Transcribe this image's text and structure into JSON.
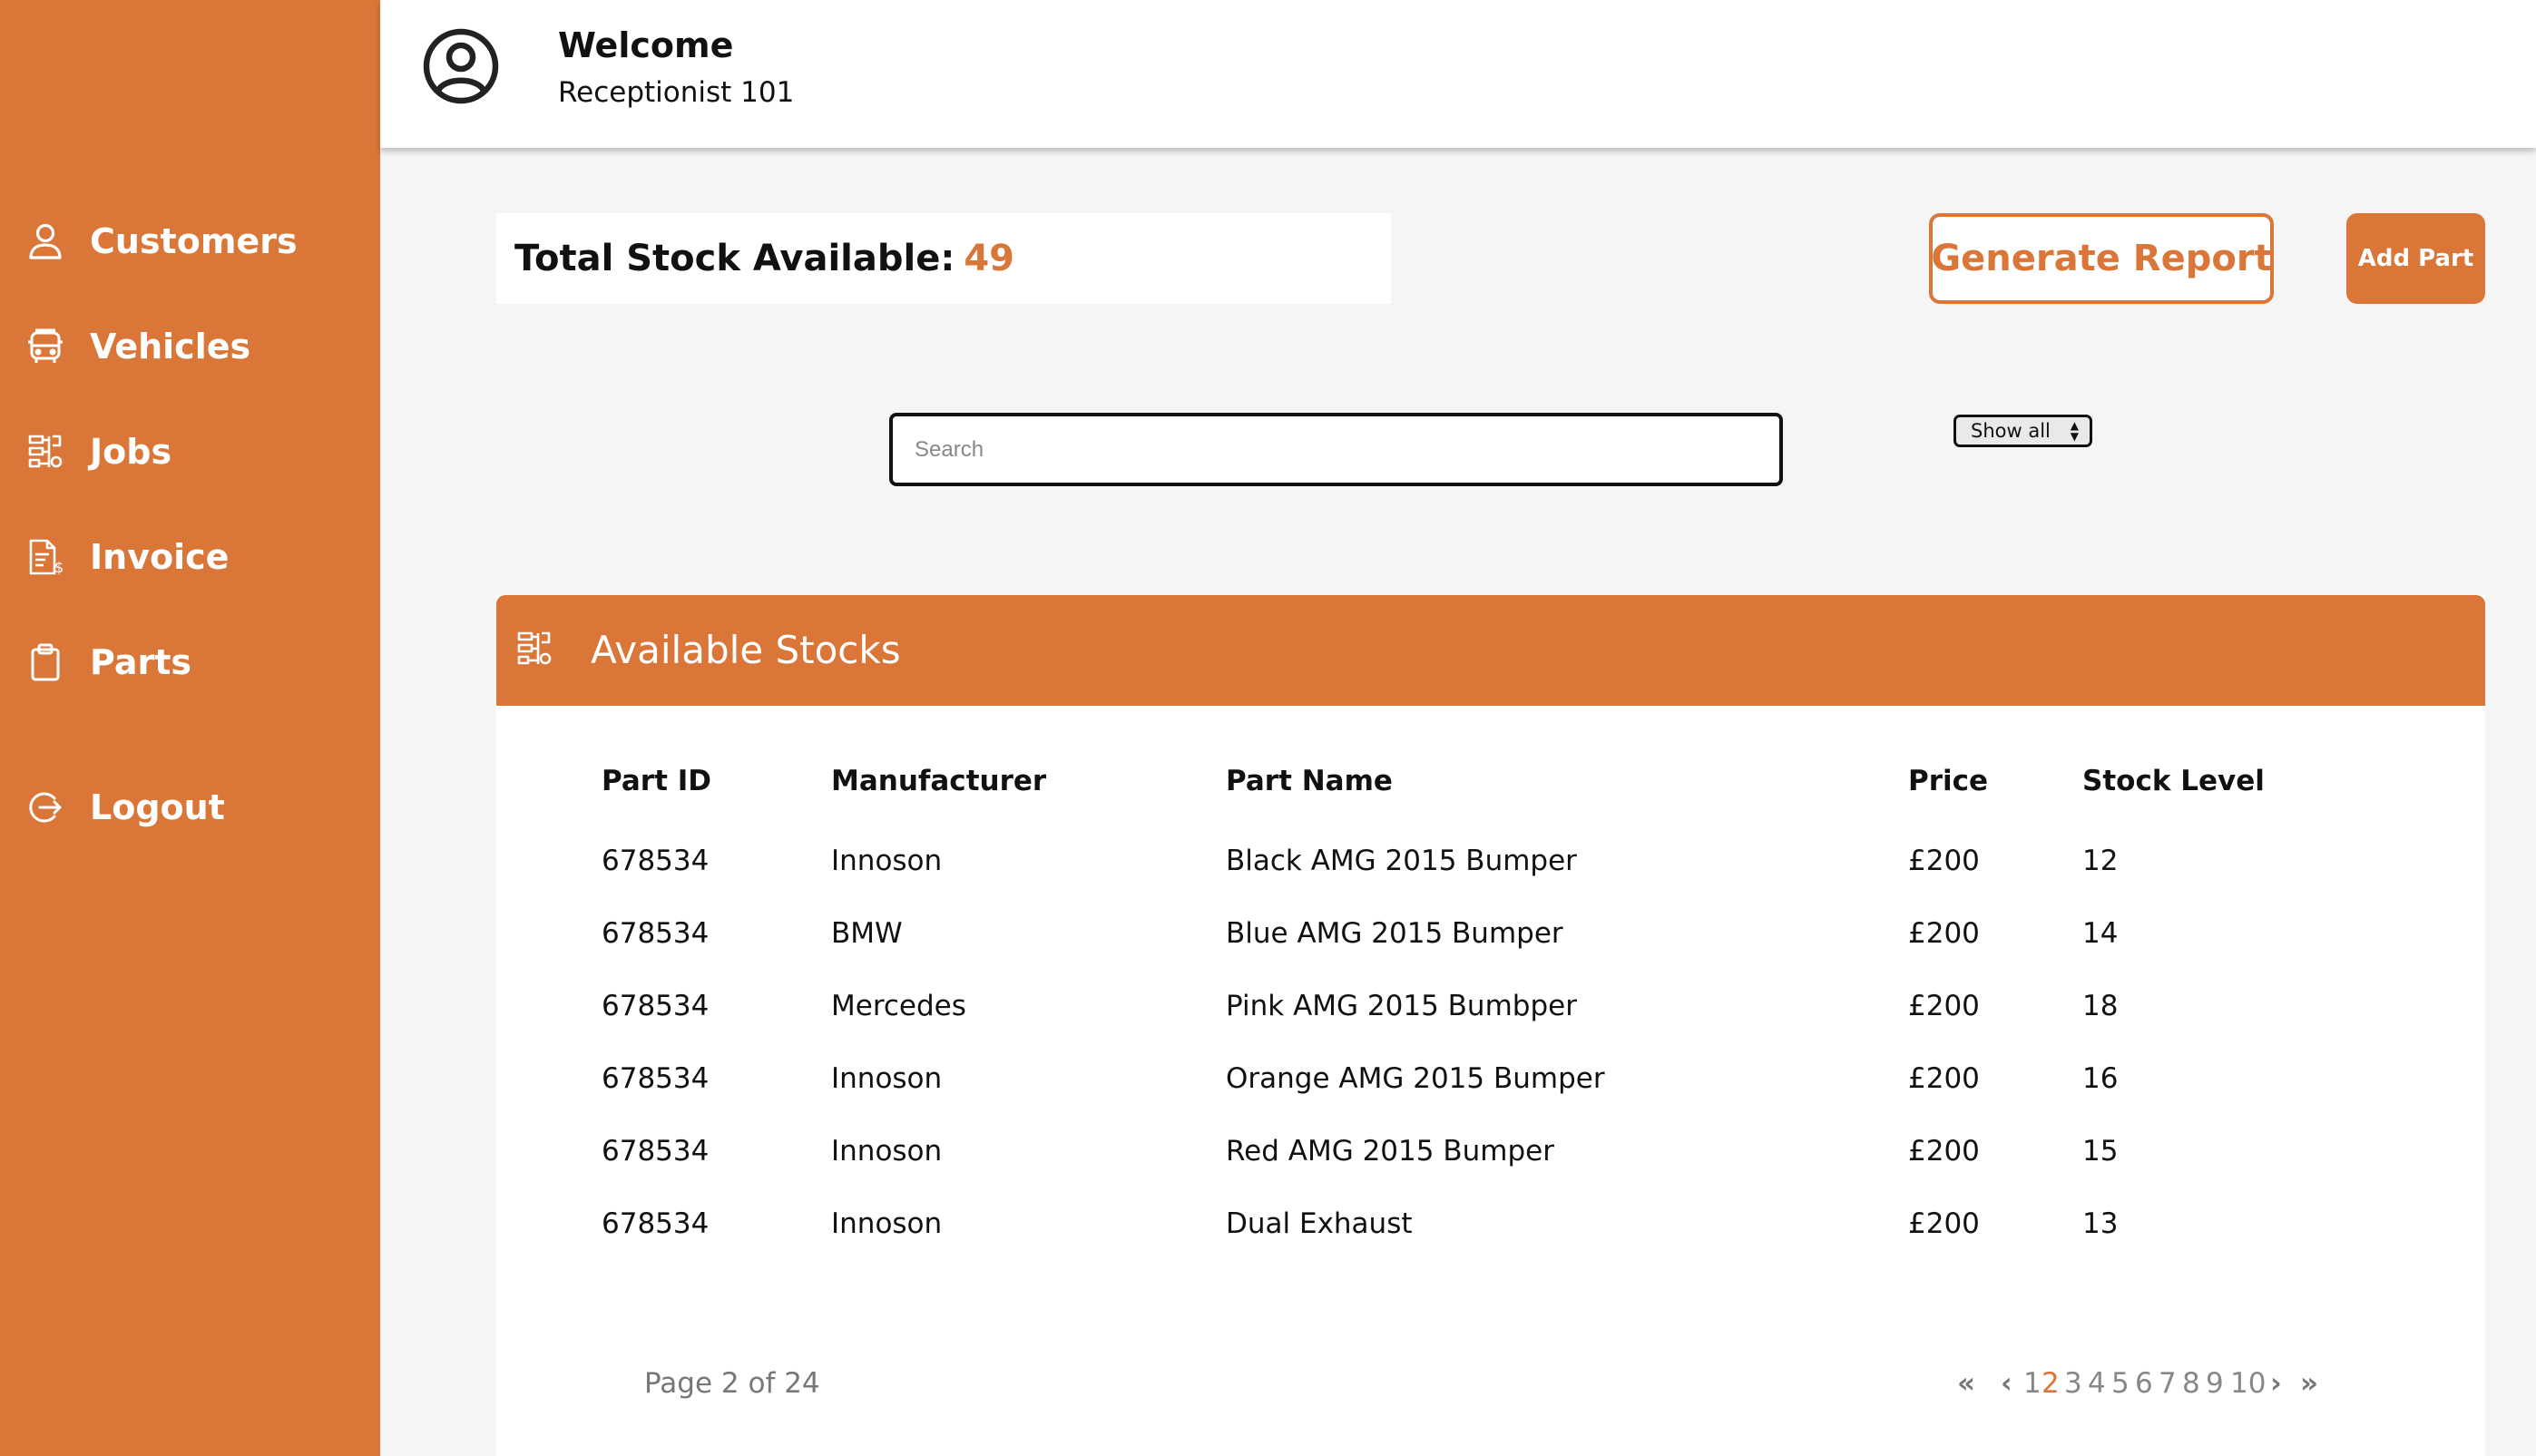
{
  "sidebar": {
    "items": [
      {
        "label": "Customers",
        "icon": "user-icon"
      },
      {
        "label": "Vehicles",
        "icon": "car-icon"
      },
      {
        "label": "Jobs",
        "icon": "parts-icon"
      },
      {
        "label": "Invoice",
        "icon": "invoice-icon"
      },
      {
        "label": "Parts",
        "icon": "clipboard-icon"
      },
      {
        "label": "Logout",
        "icon": "logout-icon"
      }
    ]
  },
  "header": {
    "welcome": "Welcome",
    "role": "Receptionist 101"
  },
  "stock": {
    "label": "Total Stock Available:",
    "value": "49"
  },
  "actions": {
    "report": "Generate Report",
    "add": "Add Part"
  },
  "search": {
    "placeholder": "Search",
    "value": ""
  },
  "filter": {
    "selected": "Show all"
  },
  "table": {
    "title": "Available Stocks",
    "columns": [
      "Part ID",
      "Manufacturer",
      "Part Name",
      "Price",
      "Stock Level"
    ],
    "rows": [
      [
        "678534",
        "Innoson",
        "Black AMG 2015 Bumper",
        "£200",
        "12"
      ],
      [
        "678534",
        "BMW",
        "Blue AMG 2015 Bumper",
        "£200",
        "14"
      ],
      [
        "678534",
        "Mercedes",
        "Pink AMG 2015 Bumbper",
        "£200",
        "18"
      ],
      [
        "678534",
        "Innoson",
        "Orange AMG 2015 Bumper",
        "£200",
        "16"
      ],
      [
        "678534",
        "Innoson",
        "Red AMG 2015 Bumper",
        "£200",
        "15"
      ],
      [
        "678534",
        "Innoson",
        "Dual Exhaust",
        "£200",
        "13"
      ]
    ]
  },
  "pagination": {
    "info": "Page 2 of 24",
    "first": "«",
    "prev": "‹",
    "pages": [
      "1",
      "2",
      "3",
      "4",
      "5",
      "6",
      "7",
      "8",
      "9",
      "10"
    ],
    "current": "2",
    "next": "›",
    "last": "»"
  },
  "colors": {
    "accent": "#D97638",
    "background": "#F5F5F5"
  }
}
